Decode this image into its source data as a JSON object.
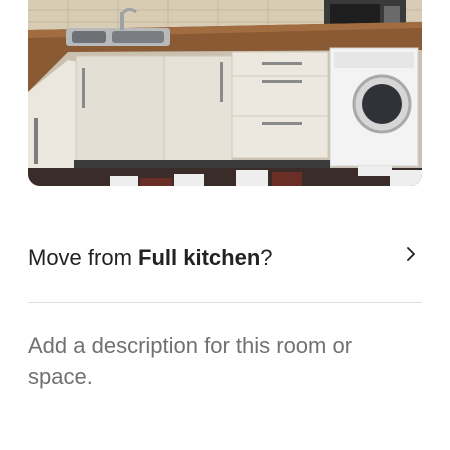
{
  "photo": {
    "subject": "kitchen-photo"
  },
  "move_row": {
    "prefix": "Move from ",
    "room_name": "Full kitchen",
    "suffix": "?",
    "icon": "chevron-right-icon"
  },
  "description": {
    "placeholder": "Add a description for this room or space."
  },
  "colors": {
    "text_primary": "#222222",
    "text_secondary": "#717171",
    "divider": "#dddddd"
  }
}
